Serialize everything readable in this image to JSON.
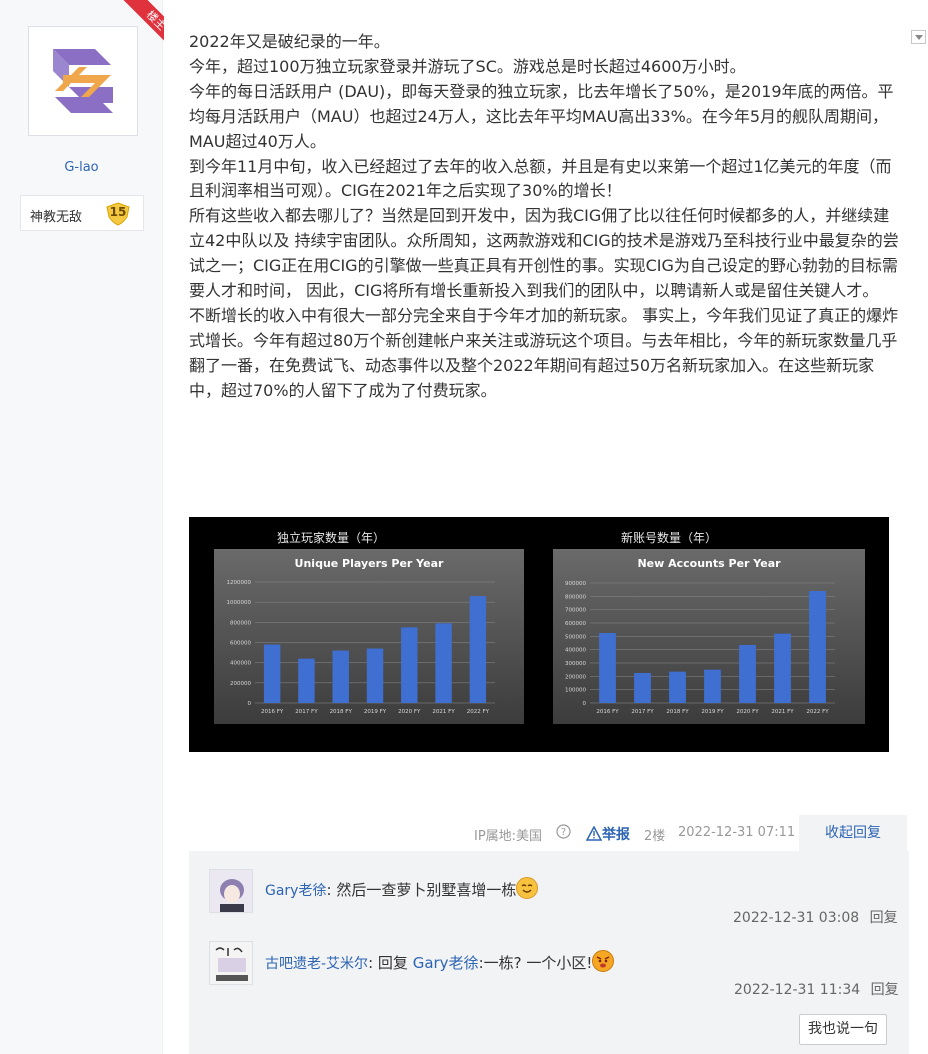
{
  "author": {
    "name": "G-lao",
    "level_title": "神教无敌",
    "level": "15",
    "badge": "楼主"
  },
  "post": {
    "paragraphs": [
      "2022年又是破纪录的一年。",
      "今年，超过100万独立玩家登录并游玩了SC。游戏总是时长超过4600万小时。",
      "今年的每日活跃用户 (DAU)，即每天登录的独立玩家，比去年增长了50%，是2019年底的两倍。平均每月活跃用户（MAU）也超过24万人，这比去年平均MAU高出33%。在今年5月的舰队周期间，MAU超过40万人。",
      "到今年11月中旬，收入已经超过了去年的收入总额，并且是有史以来第一个超过1亿美元的年度（而且利润率相当可观）。CIG在2021年之后实现了30%的增长！",
      "所有这些收入都去哪儿了？当然是回到开发中，因为我CIG佣了比以往任何时候都多的人，并继续建立42中队以及 持续宇宙团队。众所周知，这两款游戏和CIG的技术是游戏乃至科技行业中最复杂的尝试之一；CIG正在用CIG的引擎做一些真正具有开创性的事。实现CIG为自己设定的野心勃勃的目标需要人才和时间， 因此，CIG将所有增长重新投入到我们的团队中，以聘请新人或是留住关键人才。",
      "不断增长的收入中有很大一部分完全来自于今年才加的新玩家。 事实上，今年我们见证了真正的爆炸式增长。今年有超过80万个新创建帐户来关注或游玩这个项目。与去年相比，今年的新玩家数量几乎翻了一番，在免费试飞、动态事件以及整个2022年期间有超过50万名新玩家加入。在这些新玩家中，超过70%的人留下了成为了付费玩家。"
    ]
  },
  "chart_data": [
    {
      "type": "bar",
      "caption": "独立玩家数量（年）",
      "title": "Unique Players Per Year",
      "categories": [
        "2016 FY",
        "2017 FY",
        "2018 FY",
        "2019 FY",
        "2020 FY",
        "2021 FY",
        "2022 FY"
      ],
      "values": [
        580000,
        440000,
        520000,
        540000,
        750000,
        790000,
        1060000
      ],
      "yticks": [
        "0",
        "200000",
        "400000",
        "600000",
        "800000",
        "1000000",
        "1200000"
      ],
      "ylim": [
        0,
        1200000
      ],
      "color": "#3f6fd1"
    },
    {
      "type": "bar",
      "caption": "新账号数量（年）",
      "title": "New Accounts Per Year",
      "categories": [
        "2016 FY",
        "2017 FY",
        "2018 FY",
        "2019 FY",
        "2020 FY",
        "2021 FY",
        "2022 FY"
      ],
      "values": [
        525000,
        225000,
        235000,
        250000,
        435000,
        520000,
        840000
      ],
      "yticks": [
        "0",
        "100000",
        "200000",
        "300000",
        "400000",
        "500000",
        "600000",
        "700000",
        "800000",
        "900000"
      ],
      "ylim": [
        0,
        900000
      ],
      "color": "#3f6fd1"
    }
  ],
  "meta": {
    "ip": "IP属地:美国",
    "report": "举报",
    "floor": "2楼",
    "time": "2022-12-31 07:11",
    "collapse": "收起回复"
  },
  "replies": [
    {
      "user": "Gary老徐",
      "sep": ":",
      "text": "然后一查萝卜别墅喜增一栋",
      "time": "2022-12-31 03:08",
      "action": "回复"
    },
    {
      "user": "古吧遗老-艾米尔",
      "sep": ":",
      "prefix": "回复",
      "mention": "Gary老徐",
      "text": ":一栋? 一个小区!",
      "time": "2022-12-31 11:34",
      "action": "回复"
    }
  ],
  "say_button": "我也说一句"
}
